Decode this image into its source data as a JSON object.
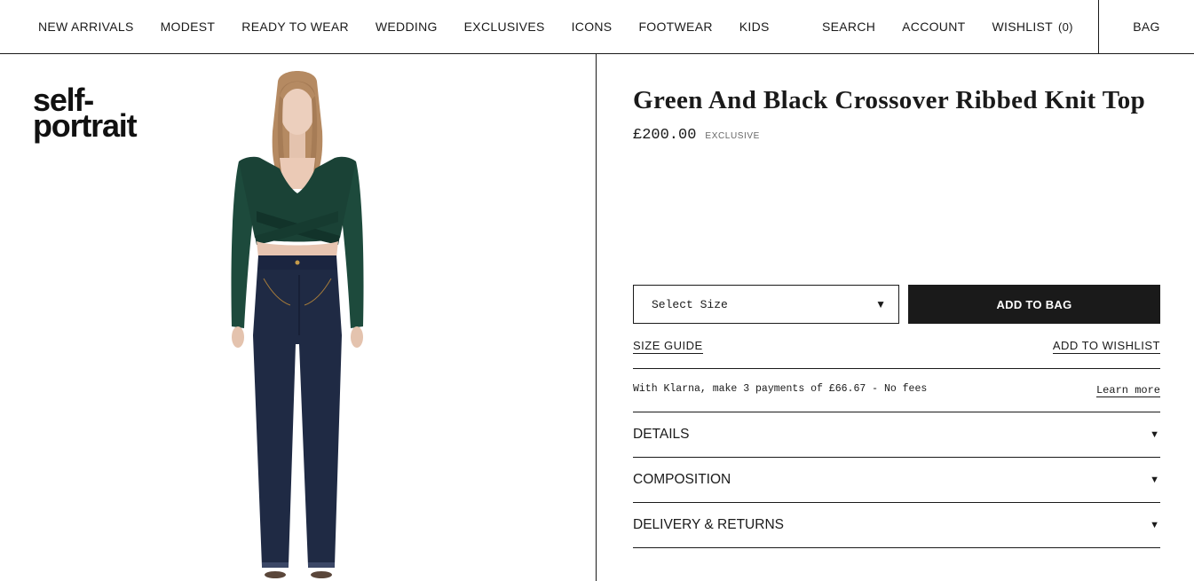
{
  "nav": {
    "left": [
      "NEW ARRIVALS",
      "MODEST",
      "READY TO WEAR",
      "WEDDING",
      "EXCLUSIVES",
      "ICONS",
      "FOOTWEAR",
      "KIDS"
    ],
    "search": "SEARCH",
    "account": "ACCOUNT",
    "wishlist": "WISHLIST",
    "wishlist_count": "(0)",
    "bag": "BAG"
  },
  "logo": {
    "line1": "self-",
    "line2": "portrait"
  },
  "product": {
    "title": "Green And Black Crossover Ribbed Knit Top",
    "price": "£200.00",
    "badge": "EXCLUSIVE",
    "size_select": "Select Size",
    "add_to_bag": "ADD TO BAG",
    "size_guide": "SIZE GUIDE",
    "add_to_wishlist": "ADD TO WISHLIST",
    "klarna_text": "With Klarna, make 3 payments of £66.67 - No fees",
    "learn_more": "Learn more",
    "accordions": [
      "DETAILS",
      "COMPOSITION",
      "DELIVERY & RETURNS"
    ]
  },
  "icons": {
    "caret": "triangle-down-icon"
  },
  "colors": {
    "text": "#1a1a1a",
    "button_bg": "#1a1a1a",
    "button_text": "#ffffff",
    "top_green": "#1d4a3c",
    "jeans": "#1f2a44"
  }
}
